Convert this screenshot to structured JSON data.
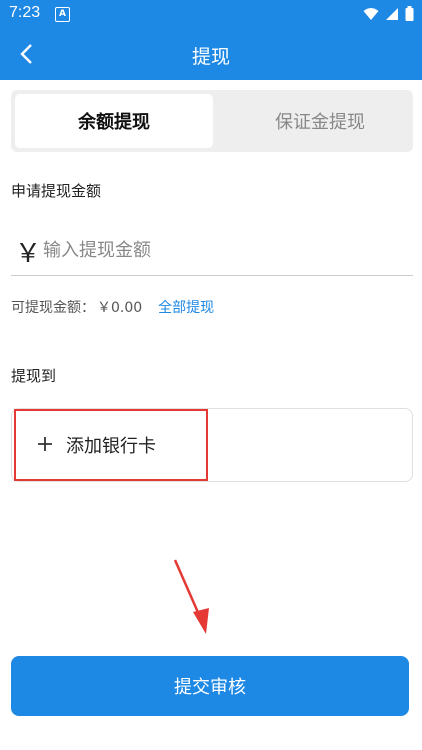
{
  "status_bar": {
    "time": "7:23",
    "notification_badge": "A",
    "icons": [
      "wifi-icon",
      "signal-icon",
      "battery-icon"
    ]
  },
  "app_bar": {
    "title": "提现",
    "back_icon": "chevron-left-icon"
  },
  "tabs": [
    {
      "label": "余额提现",
      "active": true
    },
    {
      "label": "保证金提现",
      "active": false
    }
  ],
  "form": {
    "amount_label": "申请提现金额",
    "currency_symbol": "￥",
    "amount_placeholder": "输入提现金额",
    "amount_value": "",
    "available_label": "可提现金额：",
    "available_value": "￥0.00",
    "withdraw_all_label": "全部提现",
    "destination_label": "提现到",
    "add_card_label": "添加银行卡",
    "add_card_icon": "plus-icon"
  },
  "submit_label": "提交审核",
  "colors": {
    "primary": "#1e88e5",
    "highlight_box": "#e53935",
    "arrow": "#e53935",
    "tab_background": "#eeeeee"
  }
}
